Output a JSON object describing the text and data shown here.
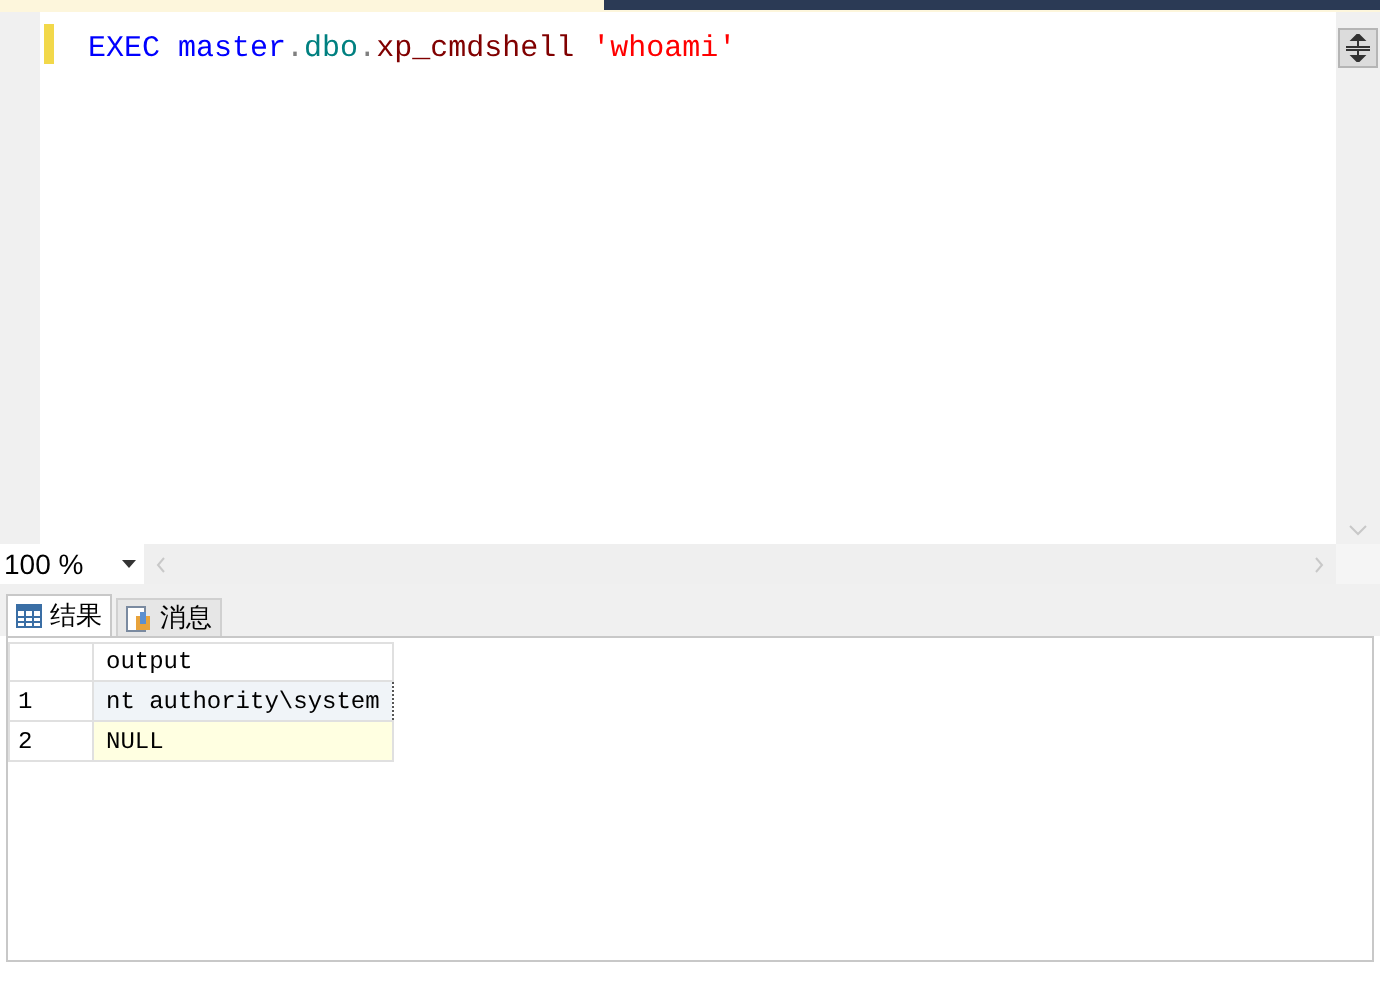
{
  "editor": {
    "tokens": [
      {
        "text": "EXEC master",
        "kind": "keyword"
      },
      {
        "text": ".",
        "kind": "punct"
      },
      {
        "text": "dbo",
        "kind": "schema"
      },
      {
        "text": ".",
        "kind": "punct"
      },
      {
        "text": "xp_cmdshell ",
        "kind": "proc"
      },
      {
        "text": "'whoami'",
        "kind": "string"
      }
    ]
  },
  "zoom": {
    "value": "100 %"
  },
  "tabs": [
    {
      "label": "结果",
      "selected": true,
      "kind": "grid"
    },
    {
      "label": "消息",
      "selected": false,
      "kind": "messages"
    }
  ],
  "grid": {
    "columns": [
      "output"
    ],
    "rows": [
      {
        "number": "1",
        "cells": [
          {
            "text": "nt authority\\system",
            "focused": true,
            "is_null": false
          }
        ]
      },
      {
        "number": "2",
        "cells": [
          {
            "text": "NULL",
            "focused": false,
            "is_null": true
          }
        ]
      }
    ]
  }
}
